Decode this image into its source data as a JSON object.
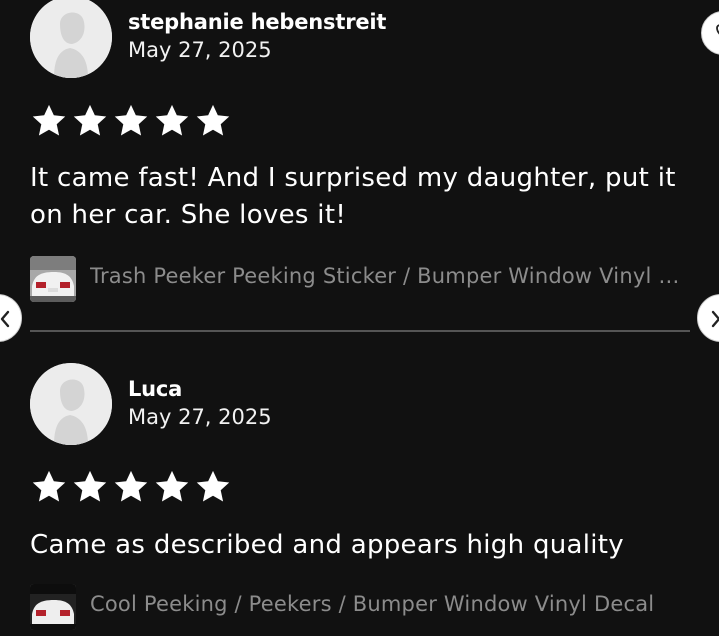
{
  "reviews": [
    {
      "reviewer": "stephanie hebenstreit",
      "date": "May 27, 2025",
      "rating": 5,
      "text": "It came fast! And I surprised my daughter, put it on her car. She loves it!",
      "item_title": "Trash Peeker Peeking Sticker / Bumper Window Vinyl Decal"
    },
    {
      "reviewer": "Luca",
      "date": "May 27, 2025",
      "rating": 5,
      "text": "Came as described and appears high quality",
      "item_title": "Cool Peeking / Peekers / Bumper Window Vinyl Decal"
    }
  ],
  "icons": {
    "avatar": "default-avatar-icon",
    "star": "star-icon",
    "prev": "chevron-left-icon",
    "next": "chevron-right-icon",
    "favorite": "heart-icon"
  },
  "colors": {
    "background": "#111111",
    "text": "#ffffff",
    "muted_text": "#8c8c8c",
    "divider": "#555555",
    "star": "#ffffff"
  }
}
